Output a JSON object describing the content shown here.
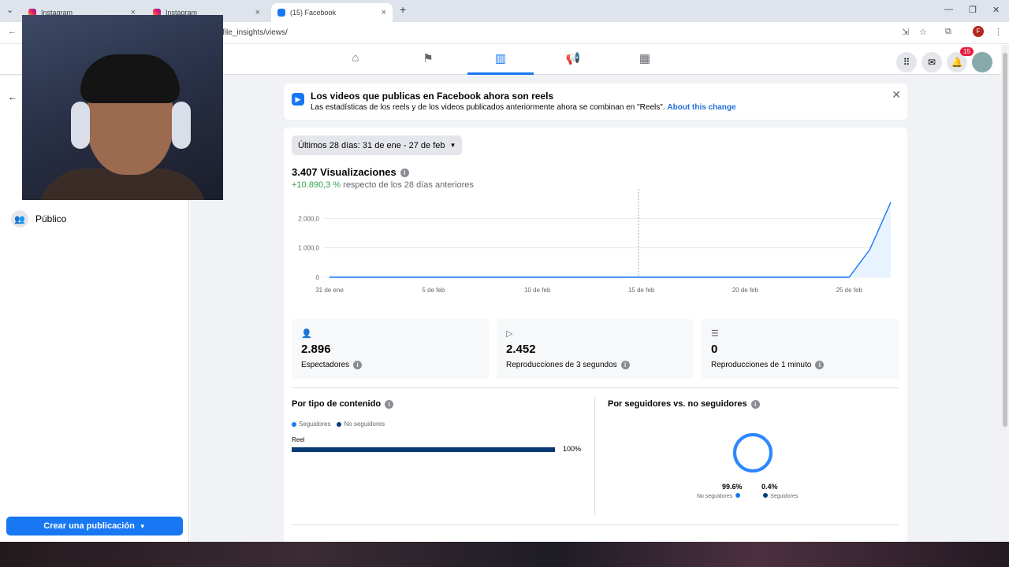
{
  "browser": {
    "tabs": [
      {
        "title": "Instagram"
      },
      {
        "title": "Instagram"
      },
      {
        "title": "(15) Facebook"
      }
    ],
    "url": "file_insights/views/"
  },
  "header": {
    "notif_count": "15",
    "avatar_letter": "F"
  },
  "sidebar": {
    "items": [
      {
        "label": "Público",
        "icon": "people-icon"
      }
    ],
    "create_button": "Crear una publicación"
  },
  "banner": {
    "title": "Los videos que publicas en Facebook ahora son reels",
    "text": "Las estadísticas de los reels y de los videos publicados anteriormente ahora se combinan en \"Reels\".",
    "link": "About this change"
  },
  "insights": {
    "date_range": "Últimos 28 días: 31 de ene - 27 de feb",
    "views_title": "3.407 Visualizaciones",
    "change_pct": "+10.890,3 %",
    "change_text": "respecto de los 28 días anteriores",
    "metrics": [
      {
        "value": "2.896",
        "label": "Espectadores",
        "icon": "person-icon"
      },
      {
        "value": "2.452",
        "label": "Reproducciones de 3 segundos",
        "icon": "play-icon"
      },
      {
        "value": "0",
        "label": "Reproducciones de 1 minuto",
        "icon": "list-play-icon"
      }
    ],
    "content_type": {
      "title": "Por tipo de contenido",
      "legend": [
        "Seguidores",
        "No seguidores"
      ],
      "rows": [
        {
          "label": "Reel",
          "pct": "100%",
          "fraction": 1.0
        }
      ]
    },
    "followers": {
      "title": "Por seguidores vs. no seguidores",
      "non_followers_pct": "99.6%",
      "non_followers_label": "No seguidores",
      "followers_pct": "0.4%",
      "followers_label": "Seguidores",
      "non_followers_fraction": 0.996
    }
  },
  "chart_data": {
    "type": "area",
    "x_ticks": [
      "31 de ene",
      "5 de feb",
      "10 de feb",
      "15 de feb",
      "20 de feb",
      "25 de feb"
    ],
    "y_ticks": [
      "0",
      "1.000,0",
      "2.000,0"
    ],
    "ylim": [
      0,
      3000
    ],
    "grid": true,
    "x": [
      0,
      5,
      10,
      15,
      20,
      25,
      26,
      27
    ],
    "values": [
      0,
      0,
      0,
      0,
      0,
      0,
      950,
      2550
    ],
    "colors": {
      "line": "#1877f2",
      "fill": "#e7f3ff"
    }
  }
}
